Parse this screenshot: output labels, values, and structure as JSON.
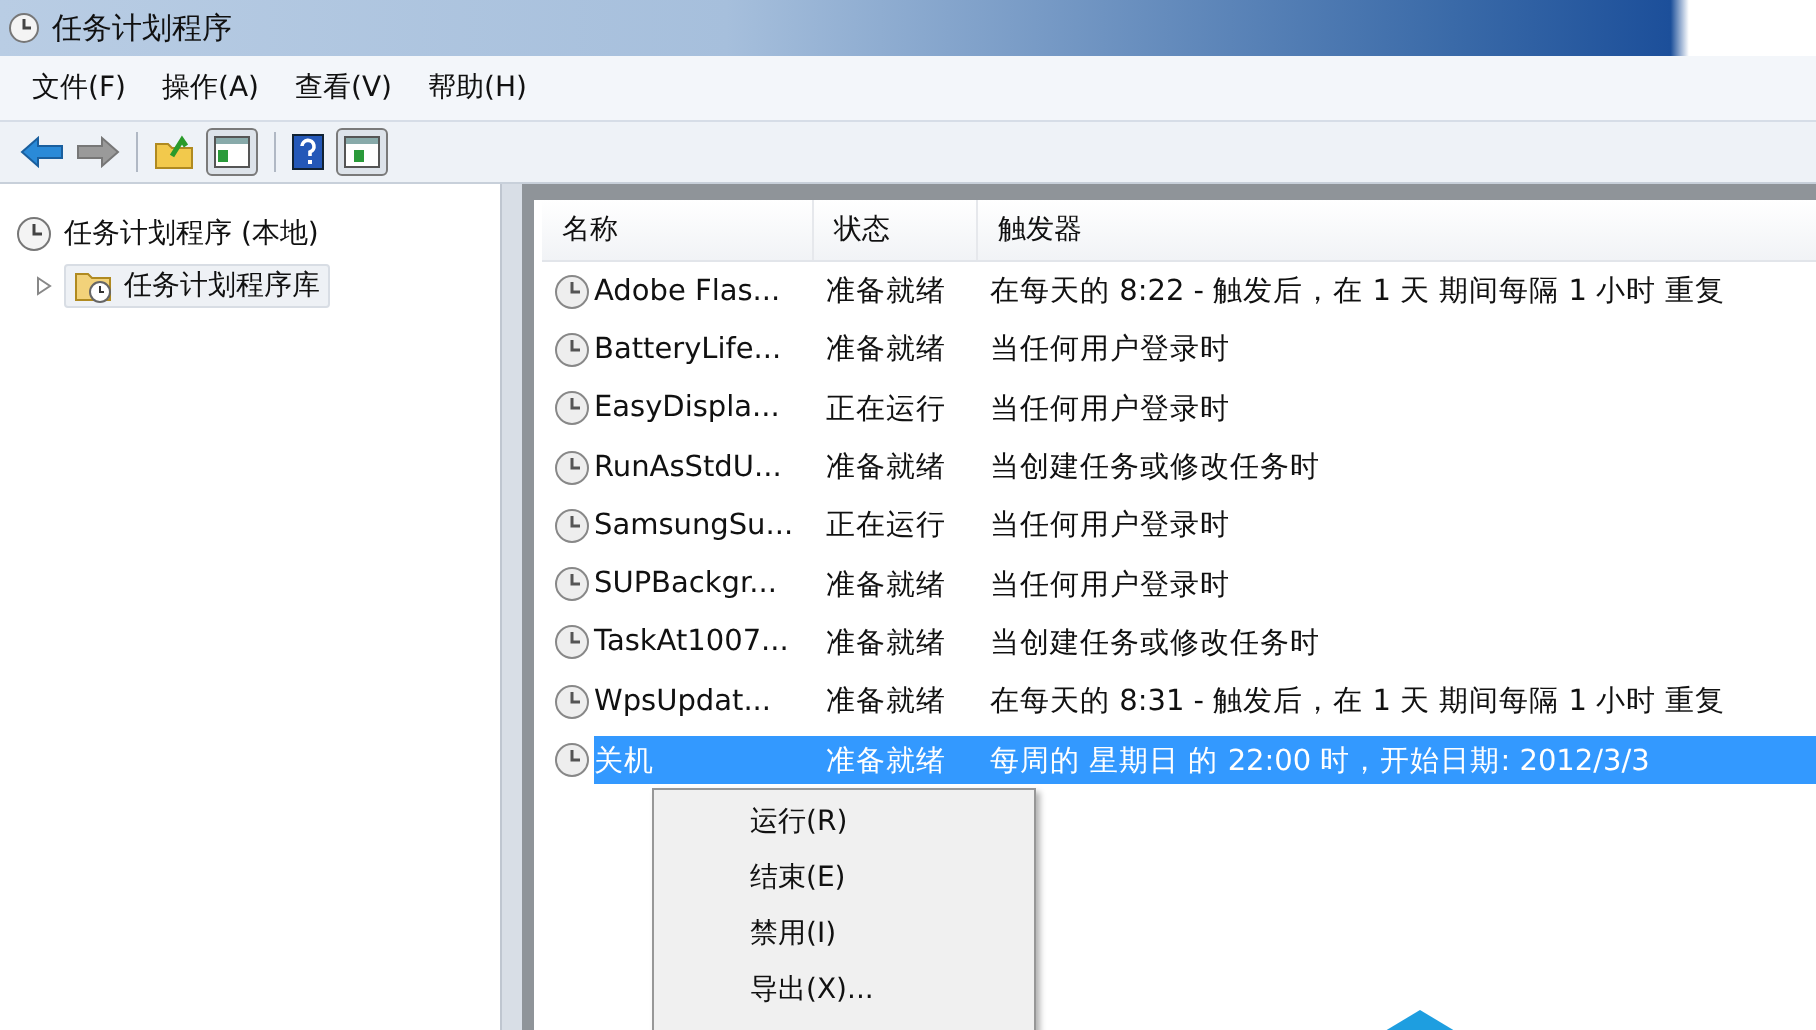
{
  "window": {
    "title": "任务计划程序"
  },
  "menu_bar": [
    "文件(F)",
    "操作(A)",
    "查看(V)",
    "帮助(H)"
  ],
  "toolbar": [
    {
      "kind": "back",
      "disabled": false
    },
    {
      "kind": "forward",
      "disabled": true
    },
    {
      "kind": "separator"
    },
    {
      "kind": "up",
      "disabled": false
    },
    {
      "kind": "pane-left",
      "pressed": true
    },
    {
      "kind": "separator"
    },
    {
      "kind": "help",
      "disabled": false
    },
    {
      "kind": "pane-right",
      "pressed": true
    }
  ],
  "tree": {
    "label": "任务计划程序 (本地)",
    "children": [
      {
        "label": "任务计划程序库",
        "selected": true,
        "expanded": false
      }
    ]
  },
  "table": {
    "columns": [
      "名称",
      "状态",
      "触发器"
    ],
    "rows": [
      {
        "name": "Adobe Flas...",
        "status": "准备就绪",
        "trigger": "在每天的 8:22 - 触发后，在 1 天 期间每隔 1 小时 重复",
        "selected": false
      },
      {
        "name": "BatteryLife...",
        "status": "准备就绪",
        "trigger": "当任何用户登录时",
        "selected": false
      },
      {
        "name": "EasyDispla...",
        "status": "正在运行",
        "trigger": "当任何用户登录时",
        "selected": false
      },
      {
        "name": "RunAsStdU...",
        "status": "准备就绪",
        "trigger": "当创建任务或修改任务时",
        "selected": false
      },
      {
        "name": "SamsungSu...",
        "status": "正在运行",
        "trigger": "当任何用户登录时",
        "selected": false
      },
      {
        "name": "SUPBackgr...",
        "status": "准备就绪",
        "trigger": "当任何用户登录时",
        "selected": false
      },
      {
        "name": "TaskAt1007...",
        "status": "准备就绪",
        "trigger": "当创建任务或修改任务时",
        "selected": false
      },
      {
        "name": "WpsUpdat...",
        "status": "准备就绪",
        "trigger": "在每天的 8:31 - 触发后，在 1 天 期间每隔 1 小时 重复",
        "selected": false
      },
      {
        "name": "关机",
        "status": "准备就绪",
        "trigger": "每周的 星期日 的 22:00 时，开始日期: 2012/3/3",
        "selected": true
      }
    ]
  },
  "context_menu": [
    "运行(R)",
    "结束(E)",
    "禁用(I)",
    "导出(X)..."
  ]
}
